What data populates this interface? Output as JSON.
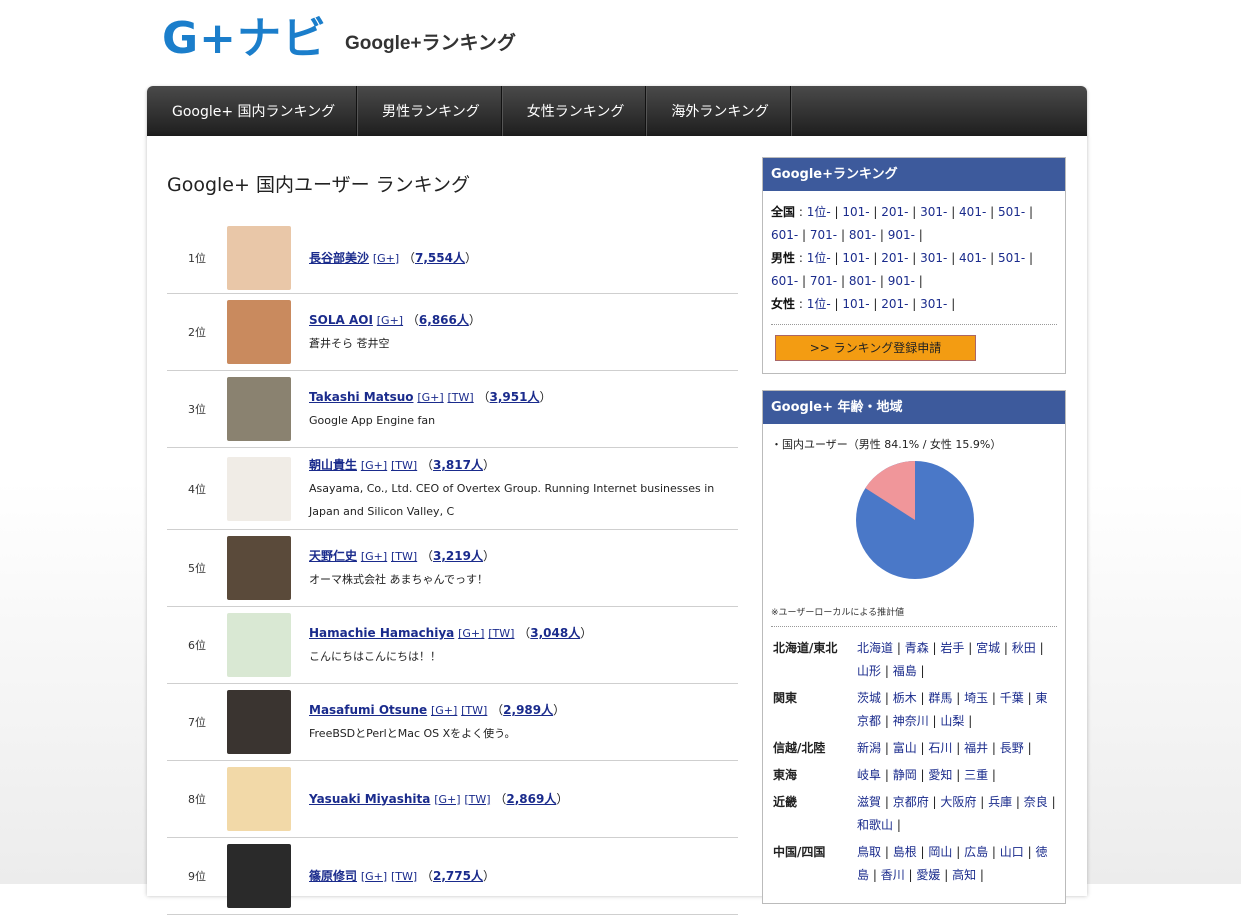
{
  "header": {
    "logo_text": "G+ナビ",
    "logo_sub": "Google+ランキング"
  },
  "nav": {
    "items": [
      {
        "label": "Google+ 国内ランキング"
      },
      {
        "label": "男性ランキング"
      },
      {
        "label": "女性ランキング"
      },
      {
        "label": "海外ランキング"
      }
    ]
  },
  "main": {
    "title": "Google+ 国内ユーザー ランキング",
    "users": [
      {
        "rank": "1位",
        "name": "長谷部美沙",
        "gplus": "[G+]",
        "tw": "",
        "count": "7,554人",
        "desc": "",
        "avatar_color": "#e9c7a8"
      },
      {
        "rank": "2位",
        "name": "SOLA AOI",
        "gplus": "[G+]",
        "tw": "",
        "count": "6,866人",
        "desc": "蒼井そら 苍井空",
        "avatar_color": "#c98a5e"
      },
      {
        "rank": "3位",
        "name": "Takashi Matsuo",
        "gplus": "[G+]",
        "tw": "[TW]",
        "count": "3,951人",
        "desc": "Google App Engine fan",
        "avatar_color": "#8a8270"
      },
      {
        "rank": "4位",
        "name": "朝山貴生",
        "gplus": "[G+]",
        "tw": "[TW]",
        "count": "3,817人",
        "desc": "Asayama, Co., Ltd. CEO of Overtex Group. Running Internet businesses in Japan and Silicon Valley, C",
        "avatar_color": "#f0ece6"
      },
      {
        "rank": "5位",
        "name": "天野仁史",
        "gplus": "[G+]",
        "tw": "[TW]",
        "count": "3,219人",
        "desc": "オーマ株式会社 あまちゃんでっす！",
        "avatar_color": "#5a4a3a"
      },
      {
        "rank": "6位",
        "name": "Hamachie Hamachiya",
        "gplus": "[G+]",
        "tw": "[TW]",
        "count": "3,048人",
        "desc": "こんにちはこんにちは！！",
        "avatar_color": "#d9e8d3"
      },
      {
        "rank": "7位",
        "name": "Masafumi Otsune",
        "gplus": "[G+]",
        "tw": "[TW]",
        "count": "2,989人",
        "desc": "FreeBSDとPerlとMac OS Xをよく使う。",
        "avatar_color": "#3a3430"
      },
      {
        "rank": "8位",
        "name": "Yasuaki Miyashita",
        "gplus": "[G+]",
        "tw": "[TW]",
        "count": "2,869人",
        "desc": "",
        "avatar_color": "#f2d9a8"
      },
      {
        "rank": "9位",
        "name": "篠原修司",
        "gplus": "[G+]",
        "tw": "[TW]",
        "count": "2,775人",
        "desc": "",
        "avatar_color": "#2a2a2a"
      }
    ]
  },
  "sidebar": {
    "ranking_box": {
      "title": "Google+ランキング",
      "groups": [
        {
          "label": "全国",
          "links": [
            "1位-",
            "101-",
            "201-",
            "301-",
            "401-",
            "501-",
            "601-",
            "701-",
            "801-",
            "901-"
          ]
        },
        {
          "label": "男性",
          "links": [
            "1位-",
            "101-",
            "201-",
            "301-",
            "401-",
            "501-",
            "601-",
            "701-",
            "801-",
            "901-"
          ]
        },
        {
          "label": "女性",
          "links": [
            "1位-",
            "101-",
            "201-",
            "301-"
          ]
        }
      ],
      "apply_button": ">> ランキング登録申請"
    },
    "demo_box": {
      "title": "Google+ 年齢・地域",
      "gender_label": "・国内ユーザー（男性 84.1% / 女性 15.9%）",
      "male_pct": 84.1,
      "female_pct": 15.9,
      "male_color": "#4a78c8",
      "female_color": "#f0969a",
      "note": "※ユーザーローカルによる推計値",
      "regions": [
        {
          "name": "北海道/東北",
          "prefs": [
            "北海道",
            "青森",
            "岩手",
            "宮城",
            "秋田",
            "山形",
            "福島"
          ]
        },
        {
          "name": "関東",
          "prefs": [
            "茨城",
            "栃木",
            "群馬",
            "埼玉",
            "千葉",
            "東京都",
            "神奈川",
            "山梨"
          ]
        },
        {
          "name": "信越/北陸",
          "prefs": [
            "新潟",
            "富山",
            "石川",
            "福井",
            "長野"
          ]
        },
        {
          "name": "東海",
          "prefs": [
            "岐阜",
            "静岡",
            "愛知",
            "三重"
          ]
        },
        {
          "name": "近畿",
          "prefs": [
            "滋賀",
            "京都府",
            "大阪府",
            "兵庫",
            "奈良",
            "和歌山"
          ]
        },
        {
          "name": "中国/四国",
          "prefs": [
            "鳥取",
            "島根",
            "岡山",
            "広島",
            "山口",
            "徳島",
            "香川",
            "愛媛",
            "高知"
          ]
        }
      ]
    }
  }
}
